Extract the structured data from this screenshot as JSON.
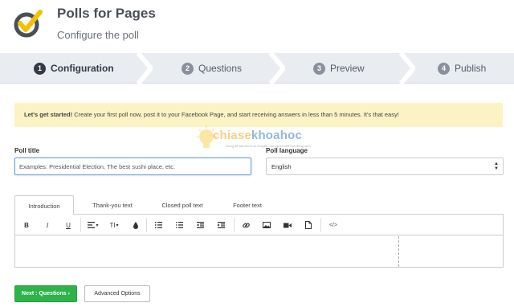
{
  "header": {
    "app_title": "Polls for Pages",
    "subtitle": "Configure the poll"
  },
  "steps": [
    {
      "num": "1",
      "label": "Configuration",
      "active": true
    },
    {
      "num": "2",
      "label": "Questions",
      "active": false
    },
    {
      "num": "3",
      "label": "Preview",
      "active": false
    },
    {
      "num": "4",
      "label": "Publish",
      "active": false
    }
  ],
  "banner": {
    "bold": "Let's get started!",
    "text": " Create your first poll now, post it to your Facebook Page, and start receiving answers in less than 5 minutes. It's that easy!"
  },
  "watermark": {
    "part1": "chiase",
    "part2": "khoahoc",
    "tagline": "Đừng để bài chính có chuyển mọi người biết bạn đang xem"
  },
  "form": {
    "poll_title_label": "Poll title",
    "poll_title_placeholder": "Examples: Presidential Election, The best sushi place, etc.",
    "poll_language_label": "Poll language",
    "poll_language_value": "English"
  },
  "tabs": [
    {
      "label": "Introduction",
      "active": true
    },
    {
      "label": "Thank-you text",
      "active": false
    },
    {
      "label": "Closed poll text",
      "active": false
    },
    {
      "label": "Footer text",
      "active": false
    }
  ],
  "toolbar": {
    "bold": "B",
    "italic": "I",
    "underline": "U",
    "align_caret": "▾",
    "text_size": "TI",
    "text_size_caret": "▾",
    "code": "</>"
  },
  "buttons": {
    "next": "Next : Questions ›",
    "advanced": "Advanced Options"
  },
  "colors": {
    "accent_yellow": "#f5c000",
    "primary_green": "#2db34a",
    "steps_bg": "#e9ecf1",
    "banner_bg": "#fbf3c4"
  }
}
